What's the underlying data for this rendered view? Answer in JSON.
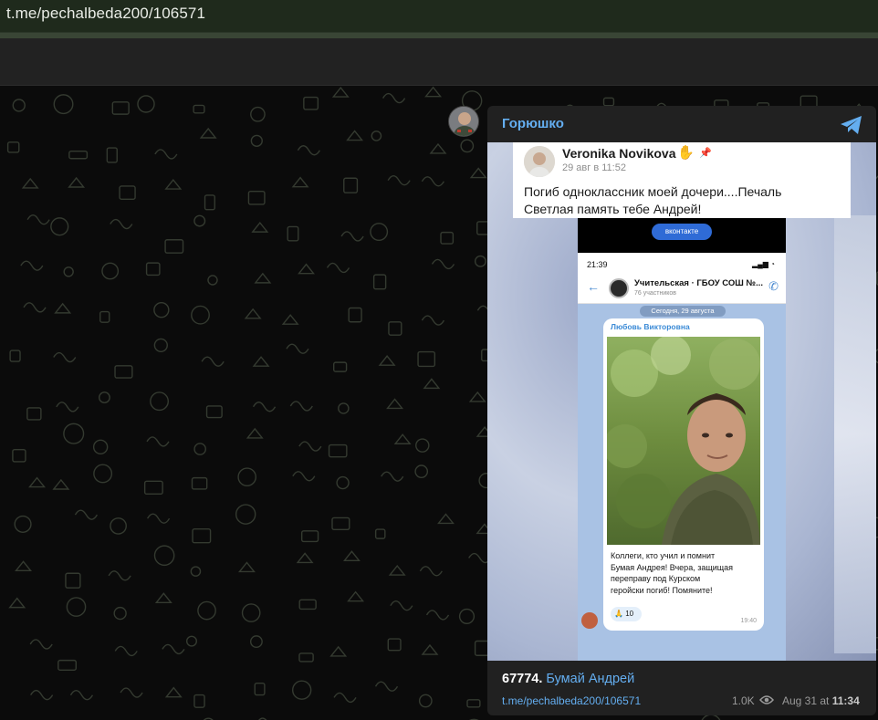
{
  "browser": {
    "url": "t.me/pechalbeda200/106571"
  },
  "post": {
    "channel_name": "Горюшко",
    "embedded_fb": {
      "author": "Veronika Novikova",
      "date": "29 авг в 11:52",
      "line1": "Погиб одноклассник моей дочери....Печаль",
      "line2": "Светлая память тебе Андрей!"
    },
    "phone": {
      "vk_button": "вконтакте",
      "time": "21:39",
      "group_name": "Учительская · ГБОУ СОШ №...",
      "group_members": "76 участников",
      "date_chip": "Сегодня, 29 августа",
      "author": "Любовь Викторовна",
      "message_lines": [
        "Коллеги,  кто учил и помнит",
        "Бумая Андрея! Вчера, защищая",
        "переправу под Курском",
        "геройски погиб! Помяните!"
      ],
      "reaction_count": "10",
      "msg_time": "19:40"
    },
    "caption_number": "67774.",
    "caption_name": "Бумай Андрей",
    "link": "t.me/pechalbeda200/106571",
    "views": "1.0K",
    "date_prefix": "Aug 31 at",
    "date_time": "11:34"
  },
  "colors": {
    "link": "#64aef0",
    "card_bg": "#212121",
    "urlbar_bg": "#1f2a1c"
  },
  "icons": {
    "telegram": "telegram-plane-icon",
    "eye": "eye-icon"
  }
}
